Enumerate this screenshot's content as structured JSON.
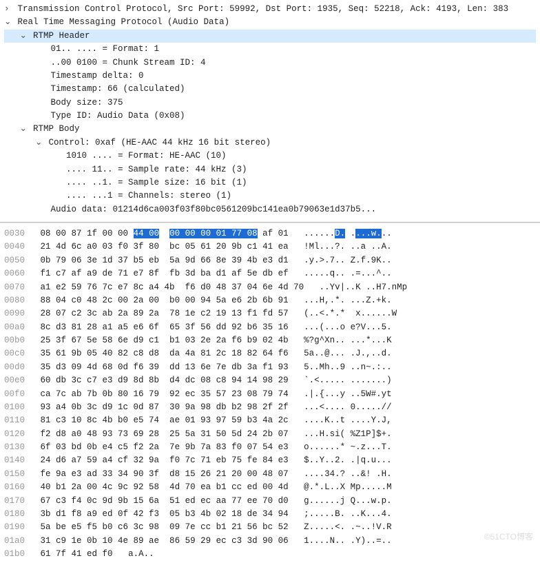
{
  "tree": {
    "tcp_line": "Transmission Control Protocol, Src Port: 59992, Dst Port: 1935, Seq: 52218, Ack: 4193, Len: 383",
    "rtmp_line": "Real Time Messaging Protocol (Audio Data)",
    "header_label": "RTMP Header",
    "header": {
      "format": "01.. .... = Format: 1",
      "chunk_id": "..00 0100 = Chunk Stream ID: 4",
      "ts_delta": "Timestamp delta: 0",
      "ts_calc": "Timestamp: 66 (calculated)",
      "body_size": "Body size: 375",
      "type_id": "Type ID: Audio Data (0x08)"
    },
    "body_label": "RTMP Body",
    "body": {
      "control": "Control: 0xaf (HE-AAC 44 kHz 16 bit stereo)",
      "format": "1010 .... = Format: HE-AAC (10)",
      "sample_rate": ".... 11.. = Sample rate: 44 kHz (3)",
      "sample_size": ".... ..1. = Sample size: 16 bit (1)",
      "channels": ".... ...1 = Channels: stereo (1)",
      "audio_data": "Audio data: 01214d6ca003f03f80bc0561209bc141ea0b79063e1d37b5..."
    }
  },
  "hex": {
    "rows": [
      {
        "off": "0030",
        "b1": "08 00 87 1f 00 00 ",
        "b2": "44 00",
        "b3": "  ",
        "b4": "00 00 00 01 77 08",
        "b5": " af 01",
        "a1": "......",
        "a2": "D.",
        "a3": " .",
        "a4": "...w.",
        "a5": ".."
      },
      {
        "off": "0040",
        "b": "21 4d 6c a0 03 f0 3f 80  bc 05 61 20 9b c1 41 ea",
        "a": "!Ml...?. ..a ..A."
      },
      {
        "off": "0050",
        "b": "0b 79 06 3e 1d 37 b5 eb  5a 9d 66 8e 39 4b e3 d1",
        "a": ".y.>.7.. Z.f.9K.."
      },
      {
        "off": "0060",
        "b": "f1 c7 af a9 de 71 e7 8f  fb 3d ba d1 af 5e db ef",
        "a": ".....q.. .=...^.."
      },
      {
        "off": "0070",
        "b": "a1 e2 59 76 7c e7 8c a4 4b  f6 d0 48 37 04 6e 4d 70",
        "a": "..Yv|..K ..H7.nMp"
      },
      {
        "off": "0080",
        "b": "88 04 c0 48 2c 00 2a 00  b0 00 94 5a e6 2b 6b 91",
        "a": "...H,.*. ...Z.+k."
      },
      {
        "off": "0090",
        "b": "28 07 c2 3c ab 2a 89 2a  78 1e c2 19 13 f1 fd 57",
        "a": "(..<.*.*  x......W"
      },
      {
        "off": "00a0",
        "b": "8c d3 81 28 a1 a5 e6 6f  65 3f 56 dd 92 b6 35 16",
        "a": "...(...o e?V...5."
      },
      {
        "off": "00b0",
        "b": "25 3f 67 5e 58 6e d9 c1  b1 03 2e 2a f6 b9 02 4b",
        "a": "%?g^Xn.. ...*...K"
      },
      {
        "off": "00c0",
        "b": "35 61 9b 05 40 82 c8 d8  da 4a 81 2c 18 82 64 f6",
        "a": "5a..@... .J.,..d."
      },
      {
        "off": "00d0",
        "b": "35 d3 09 4d 68 0d f6 39  dd 13 6e 7e db 3a f1 93",
        "a": "5..Mh..9 ..n~.:.."
      },
      {
        "off": "00e0",
        "b": "60 db 3c c7 e3 d9 8d 8b  d4 dc 08 c8 94 14 98 29",
        "a": "`.<..... .......)"
      },
      {
        "off": "00f0",
        "b": "ca 7c ab 7b 0b 80 16 79  92 ec 35 57 23 08 79 74",
        "a": ".|.{...y ..5W#.yt"
      },
      {
        "off": "0100",
        "b": "93 a4 0b 3c d9 1c 0d 87  30 9a 98 db b2 98 2f 2f",
        "a": "...<.... 0.....//"
      },
      {
        "off": "0110",
        "b": "81 c3 10 8c 4b b0 e5 74  ae 01 93 97 59 b3 4a 2c",
        "a": "....K..t ....Y.J,"
      },
      {
        "off": "0120",
        "b": "f2 d8 a0 48 93 73 69 28  25 5a 31 50 5d 24 2b 07",
        "a": "...H.si( %Z1P]$+."
      },
      {
        "off": "0130",
        "b": "6f 03 bd 0b e4 c5 f2 2a  7e 9b 7a 83 f0 07 54 e3",
        "a": "o......* ~.z...T."
      },
      {
        "off": "0140",
        "b": "24 d6 a7 59 a4 cf 32 9a  f0 7c 71 eb 75 fe 84 e3",
        "a": "$..Y..2. .|q.u..."
      },
      {
        "off": "0150",
        "b": "fe 9a e3 ad 33 34 90 3f  d8 15 26 21 20 00 48 07",
        "a": "....34.? ..&! .H."
      },
      {
        "off": "0160",
        "b": "40 b1 2a 00 4c 9c 92 58  4d 70 ea b1 cc ed 00 4d",
        "a": "@.*.L..X Mp.....M"
      },
      {
        "off": "0170",
        "b": "67 c3 f4 0c 9d 9b 15 6a  51 ed ec aa 77 ee 70 d0",
        "a": "g......j Q...w.p."
      },
      {
        "off": "0180",
        "b": "3b d1 f8 a9 ed 0f 42 f3  05 b3 4b 02 18 de 34 94",
        "a": ";.....B. ..K...4."
      },
      {
        "off": "0190",
        "b": "5a be e5 f5 b0 c6 3c 98  09 7e cc b1 21 56 bc 52",
        "a": "Z.....<. .~..!V.R"
      },
      {
        "off": "01a0",
        "b": "31 c9 1e 0b 10 4e 89 ae  86 59 29 ec c3 3d 90 06",
        "a": "1....N.. .Y)..=.."
      },
      {
        "off": "01b0",
        "b": "61 7f 41 ed f0",
        "a": "a.A.."
      }
    ]
  },
  "watermark": "©51CTO博客"
}
